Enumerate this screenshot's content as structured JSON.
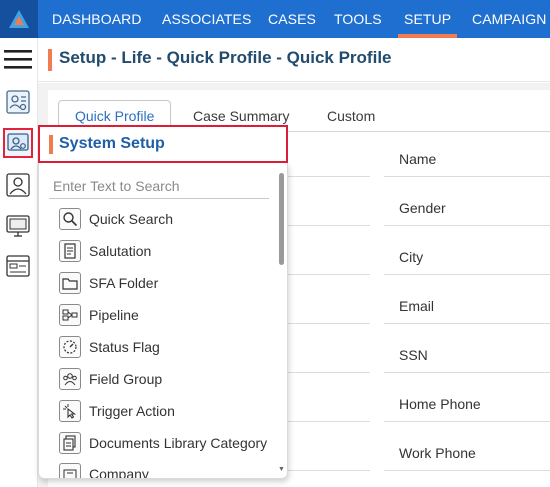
{
  "nav": {
    "items": [
      {
        "label": "DASHBOARD"
      },
      {
        "label": "ASSOCIATES"
      },
      {
        "label": "CASES"
      },
      {
        "label": "TOOLS"
      },
      {
        "label": "SETUP"
      },
      {
        "label": "CAMPAIGN"
      }
    ],
    "active": "SETUP"
  },
  "header": {
    "title": "Setup - Life - Quick Profile - Quick Profile"
  },
  "tabs": [
    {
      "label": "Quick Profile"
    },
    {
      "label": "Case Summary"
    },
    {
      "label": "Custom"
    }
  ],
  "fields": [
    {
      "label": "Name"
    },
    {
      "label": "Gender"
    },
    {
      "label": "City"
    },
    {
      "label": "Email"
    },
    {
      "label": "SSN"
    },
    {
      "label": "Home Phone"
    },
    {
      "label": "Work Phone"
    }
  ],
  "system_setup": {
    "title": "System Setup",
    "search_placeholder": "Enter Text to Search",
    "items": [
      {
        "label": "Quick Search",
        "icon": "magnifier-icon"
      },
      {
        "label": "Salutation",
        "icon": "document-icon"
      },
      {
        "label": "SFA Folder",
        "icon": "folder-icon"
      },
      {
        "label": "Pipeline",
        "icon": "pipeline-icon"
      },
      {
        "label": "Status Flag",
        "icon": "status-dial-icon"
      },
      {
        "label": "Field Group",
        "icon": "group-icon"
      },
      {
        "label": "Trigger Action",
        "icon": "pointer-click-icon"
      },
      {
        "label": "Documents Library Category",
        "icon": "documents-icon"
      },
      {
        "label": "Company",
        "icon": "company-icon"
      }
    ]
  },
  "colors": {
    "nav_bg": "#1f6fd1",
    "accent": "#f07c52",
    "highlight_border": "#d91e35",
    "title_text": "#234b6e"
  }
}
